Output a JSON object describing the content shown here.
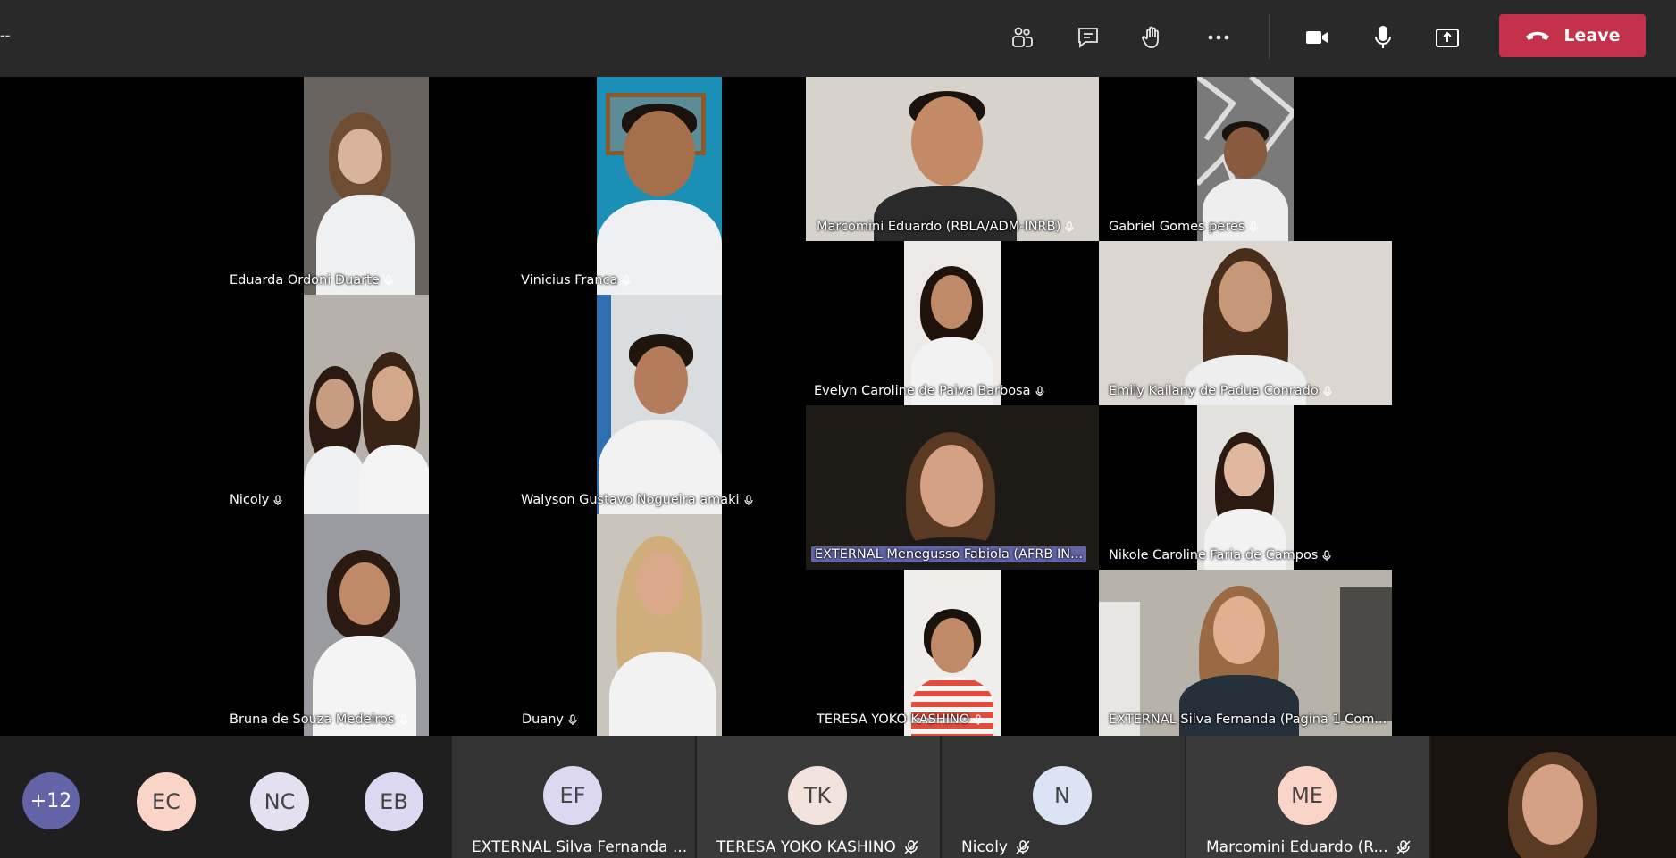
{
  "topbar": {
    "left_text": "--",
    "leave_label": "Leave",
    "icons": [
      "participants-icon",
      "chat-icon",
      "raise-hand-icon",
      "more-icon",
      "camera-icon",
      "mic-icon",
      "share-icon",
      "hangup-icon"
    ]
  },
  "grid": {
    "tiles": [
      {
        "name": "Eduarda Ordoni Duarte"
      },
      {
        "name": "Vinicius  Franca"
      },
      {
        "name": "Marcomini Eduardo (RBLA/ADM-INRB)"
      },
      {
        "name": "Gabriel Gomes peres"
      },
      {
        "name": "Nicoly"
      },
      {
        "name": "Walyson Gustavo Nogueira amaki"
      },
      {
        "name": "Evelyn Caroline de Paiva Barbosa"
      },
      {
        "name": "Emily Kailany de Padua Conrado"
      },
      {
        "name": "EXTERNAL Menegusso Fabiola (AFRB IN..."
      },
      {
        "name": "Nikole Caroline Faria de Campos"
      },
      {
        "name": "Bruna de Souza Medeiros"
      },
      {
        "name": "Duany"
      },
      {
        "name": "TERESA YOKO KASHINO"
      },
      {
        "name": "EXTERNAL Silva Fernanda (Pagina 1 Com..."
      }
    ]
  },
  "bottombar": {
    "overflow_count": "+12",
    "small_avatars": [
      "EC",
      "NC",
      "EB"
    ],
    "strip": [
      {
        "initials": "EF",
        "name": "EXTERNAL Silva Fernanda ..."
      },
      {
        "initials": "TK",
        "name": "TERESA YOKO KASHINO"
      },
      {
        "initials": "N",
        "name": "Nicoly"
      },
      {
        "initials": "ME",
        "name": "Marcomini Eduardo (R..."
      }
    ]
  },
  "colors": {
    "accent": "#6264a7",
    "leave": "#c4314b",
    "topbar": "#292929"
  }
}
